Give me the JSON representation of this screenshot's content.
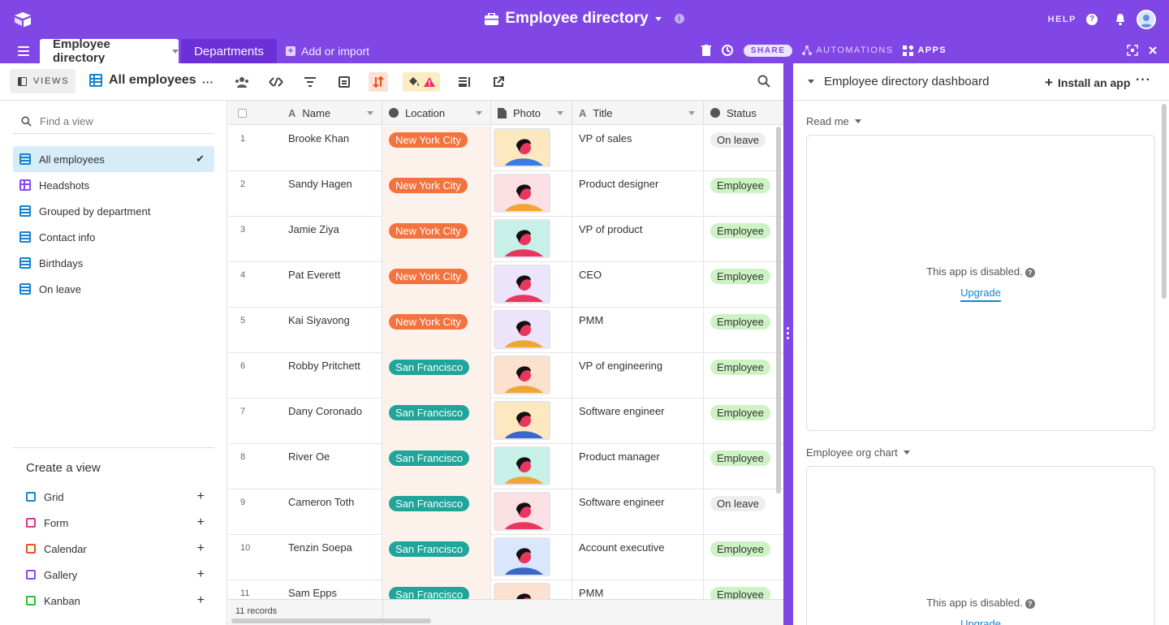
{
  "header": {
    "base_title": "Employee directory",
    "help_label": "HELP"
  },
  "tabs": {
    "active": "Employee directory",
    "other": "Departments",
    "add_import": "Add or import",
    "share": "SHARE",
    "automations": "AUTOMATIONS",
    "apps": "APPS"
  },
  "viewbar": {
    "views_label": "VIEWS",
    "current_view": "All employees"
  },
  "sidebar": {
    "find_placeholder": "Find a view",
    "views": [
      {
        "label": "All employees",
        "icon": "grid-icon",
        "active": true
      },
      {
        "label": "Headshots",
        "icon": "gallery-icon"
      },
      {
        "label": "Grouped by department",
        "icon": "grid-icon"
      },
      {
        "label": "Contact info",
        "icon": "grid-icon"
      },
      {
        "label": "Birthdays",
        "icon": "grid-icon"
      },
      {
        "label": "On leave",
        "icon": "grid-icon"
      }
    ],
    "create_title": "Create a view",
    "create_items": [
      {
        "label": "Grid",
        "color": "#1583d1"
      },
      {
        "label": "Form",
        "color": "#e4348d"
      },
      {
        "label": "Calendar",
        "color": "#f04f1a"
      },
      {
        "label": "Gallery",
        "color": "#8b46ff"
      },
      {
        "label": "Kanban",
        "color": "#20c933"
      }
    ]
  },
  "grid": {
    "columns": [
      "Name",
      "Location",
      "Photo",
      "Title",
      "Status"
    ],
    "rows": [
      {
        "n": "1",
        "name": "Brooke Khan",
        "location": "New York City",
        "title": "VP of sales",
        "status": "On leave"
      },
      {
        "n": "2",
        "name": "Sandy Hagen",
        "location": "New York City",
        "title": "Product designer",
        "status": "Employee"
      },
      {
        "n": "3",
        "name": "Jamie Ziya",
        "location": "New York City",
        "title": "VP of product",
        "status": "Employee"
      },
      {
        "n": "4",
        "name": "Pat Everett",
        "location": "New York City",
        "title": "CEO",
        "status": "Employee"
      },
      {
        "n": "5",
        "name": "Kai Siyavong",
        "location": "New York City",
        "title": "PMM",
        "status": "Employee"
      },
      {
        "n": "6",
        "name": "Robby Pritchett",
        "location": "San Francisco",
        "title": "VP of engineering",
        "status": "Employee"
      },
      {
        "n": "7",
        "name": "Dany Coronado",
        "location": "San Francisco",
        "title": "Software engineer",
        "status": "Employee"
      },
      {
        "n": "8",
        "name": "River Oe",
        "location": "San Francisco",
        "title": "Product manager",
        "status": "Employee"
      },
      {
        "n": "9",
        "name": "Cameron Toth",
        "location": "San Francisco",
        "title": "Software engineer",
        "status": "On leave"
      },
      {
        "n": "10",
        "name": "Tenzin Soepa",
        "location": "San Francisco",
        "title": "Account executive",
        "status": "Employee"
      },
      {
        "n": "11",
        "name": "Sam Epps",
        "location": "San Francisco",
        "title": "PMM",
        "status": "Employee"
      }
    ],
    "record_count": "11 records"
  },
  "dashboard": {
    "title": "Employee directory dashboard",
    "install": "Install an app",
    "apps": [
      {
        "label": "Read me",
        "message": "This app is disabled.",
        "upgrade": "Upgrade"
      },
      {
        "label": "Employee org chart",
        "message": "This app is disabled.",
        "upgrade": "Upgrade"
      }
    ]
  }
}
